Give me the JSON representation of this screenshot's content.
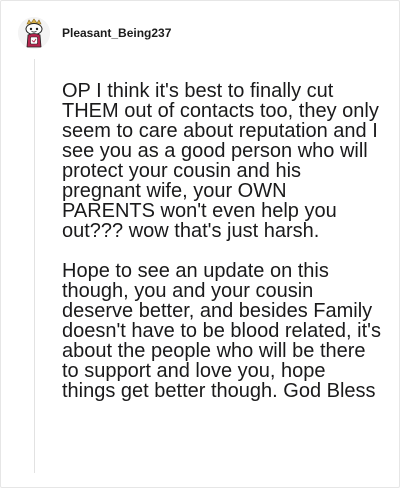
{
  "comment": {
    "username": "Pleasant_Being237",
    "avatar_icon": "snoo-avatar-icon",
    "paragraphs": [
      "OP I think it's best to finally cut THEM out of contacts too, they only seem to care about reputation and I see you as a good person who will protect your cousin and his pregnant wife, your OWN PARENTS won't even help you out??? wow that's just harsh.",
      "Hope to see an update on this though, you and your cousin deserve better, and besides Family doesn't have to be blood related, it's about the people who will be there to support and love you, hope things get better though. God Bless"
    ]
  },
  "colors": {
    "text": "#1a1a1b",
    "border": "#e6e6e6",
    "thread_line": "#e2e2e2",
    "avatar_bg": "#f2f2f2",
    "avatar_accent": "#c9a64a"
  }
}
